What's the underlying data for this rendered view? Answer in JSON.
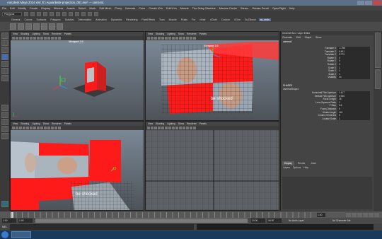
{
  "window": {
    "title": "Autodesk Maya 2014 x64: E:\\ Aquarilastir-projection_001.ma*  ---  camera1"
  },
  "menubar": {
    "items": [
      "File",
      "Edit",
      "Modify",
      "Create",
      "Display",
      "Window",
      "Assets",
      "Select",
      "Mesh",
      "Edit Mesh",
      "Proxy",
      "Normals",
      "Color",
      "Create UVs",
      "Edit UVs",
      "Muscle",
      "The Setup Machine",
      "Maxime Cache",
      "Stereo",
      "Grease Pencil",
      "OpenFlight",
      "Help"
    ]
  },
  "statusline": {
    "mode": "Polygons"
  },
  "shelf": {
    "tabs": [
      "General",
      "Curves",
      "Surfaces",
      "Polygons",
      "Subdivs",
      "Deformation",
      "Animation",
      "Dynamics",
      "Rendering",
      "PaintEffects",
      "Toon",
      "Muscle",
      "Fluids",
      "Fur",
      "nHair",
      "nCloth",
      "Custom",
      "XGen",
      "GoZBrush",
      "ss_reels"
    ],
    "active_tab": "ss_reels"
  },
  "panel_menu": [
    "View",
    "Shading",
    "Lighting",
    "Show",
    "Renderer",
    "Panels"
  ],
  "viewports": {
    "persp": {
      "label": "Viewport 2.0"
    },
    "camera": {
      "label": "Viewport 2.0"
    },
    "overlay_text": "be shocked"
  },
  "channelbox": {
    "header": "Channel Box / Layer Editor",
    "menus": [
      "Channels",
      "Edit",
      "Object",
      "Show"
    ],
    "object": "camera1",
    "transform": [
      {
        "label": "Translate X",
        "value": "-1.295"
      },
      {
        "label": "Translate Y",
        "value": "6.491"
      },
      {
        "label": "Translate Z",
        "value": "5.779"
      },
      {
        "label": "Rotate X",
        "value": "0"
      },
      {
        "label": "Rotate Y",
        "value": "0"
      },
      {
        "label": "Rotate Z",
        "value": "0"
      },
      {
        "label": "Scale X",
        "value": "1"
      },
      {
        "label": "Scale Y",
        "value": "1"
      },
      {
        "label": "Scale Z",
        "value": "1"
      },
      {
        "label": "Visibility",
        "value": "on"
      }
    ],
    "shapes_header": "SHAPES",
    "shape_name": "cameraShape1",
    "shape_attrs": [
      {
        "label": "Horizontal Film Aperture",
        "value": "1.417"
      },
      {
        "label": "Vertical Film Aperture",
        "value": "0.945"
      },
      {
        "label": "Focal Length",
        "value": "35"
      },
      {
        "label": "Lens Squeeze Ratio",
        "value": "1"
      },
      {
        "label": "F Stop",
        "value": "5.6"
      },
      {
        "label": "Focus Distance",
        "value": "5"
      },
      {
        "label": "Shutter Angle",
        "value": "144"
      },
      {
        "label": "Center Of Interest",
        "value": "5"
      },
      {
        "label": "Locator Scale",
        "value": "1"
      }
    ]
  },
  "layers": {
    "tabs": [
      "Display",
      "Render",
      "Anim"
    ],
    "active": "Display",
    "menus": [
      "Layers",
      "Options",
      "Help"
    ]
  },
  "time": {
    "current_frame": "1.00",
    "start": "1.00",
    "range_start": "1.00",
    "range_end": "24.00",
    "end": "48.00",
    "anim_layer": "No Anim Layer",
    "char_set": "No Character Set"
  },
  "cmdline": {
    "label": "MEL"
  },
  "colors": {
    "red_plane": "#ff1a1a",
    "viewport_bg_top": "#7c8a96",
    "viewport_bg_bottom": "#4a4f55",
    "grid": "#2e2e2e"
  }
}
